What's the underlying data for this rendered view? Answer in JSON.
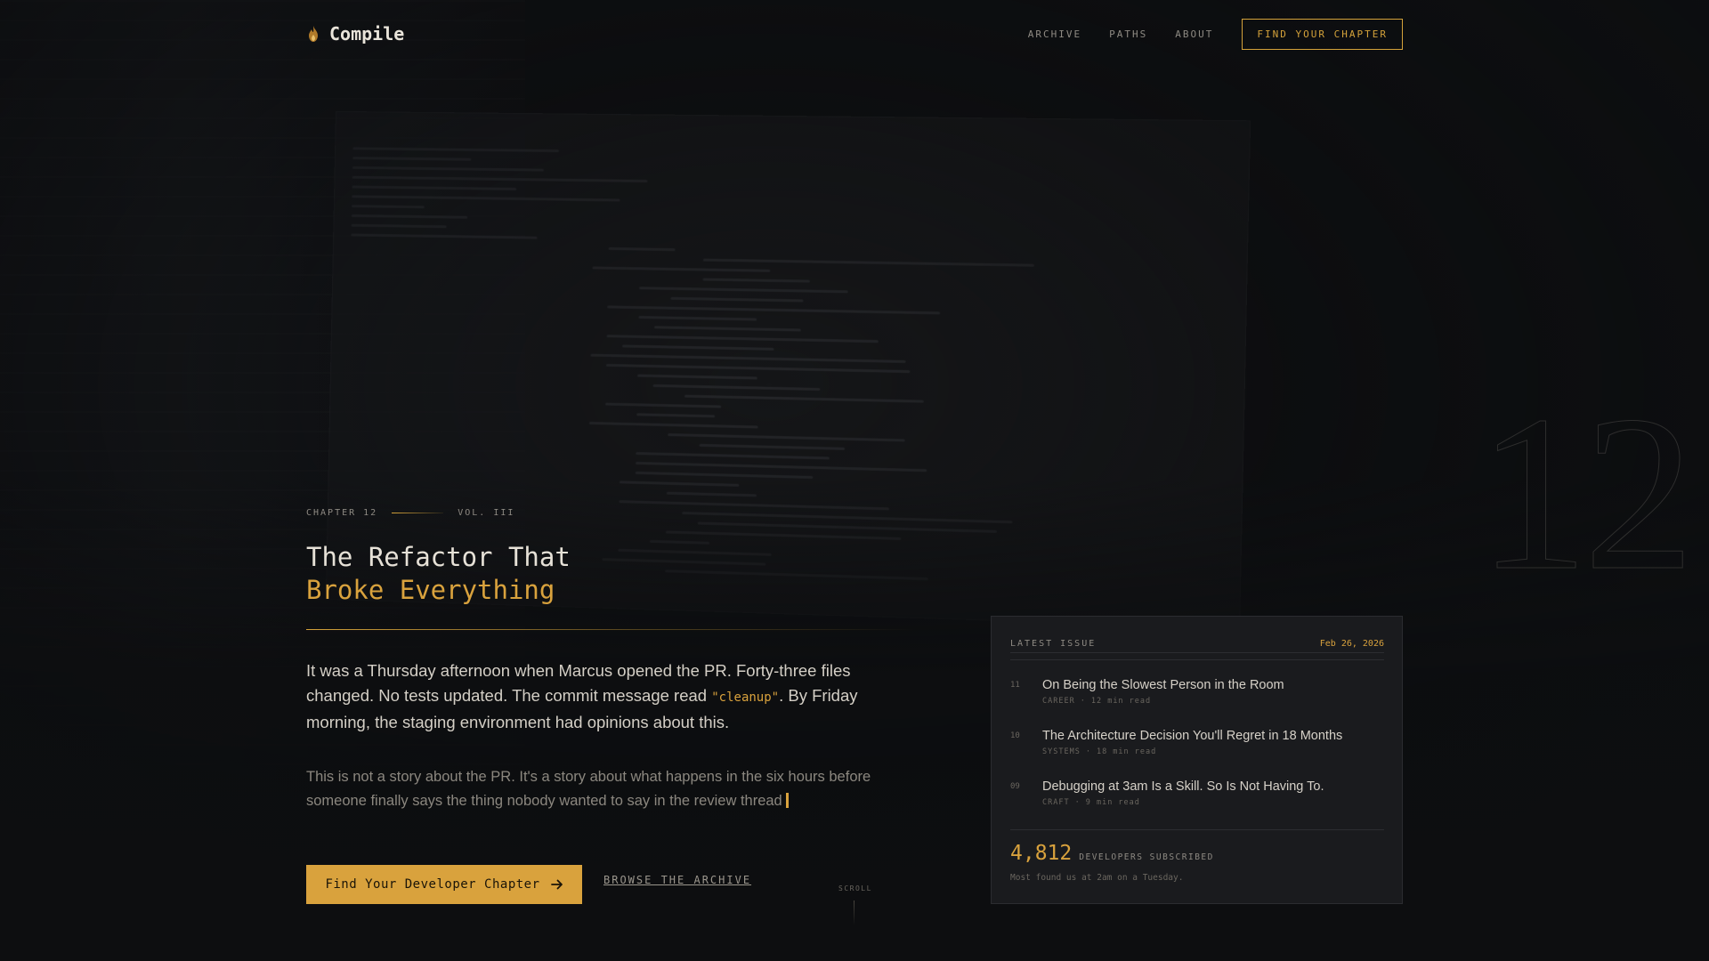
{
  "brand": {
    "name": "Compile",
    "icon": "flame-icon"
  },
  "nav": {
    "items": [
      "ARCHIVE",
      "PATHS",
      "ABOUT"
    ],
    "cta": "FIND YOUR CHAPTER"
  },
  "chapter": {
    "label": "CHAPTER 12",
    "volume": "VOL. III",
    "big_number": "12"
  },
  "headline": {
    "line1": "The Refactor That",
    "line2": "Broke Everything"
  },
  "lead": {
    "before": "It was a Thursday afternoon when Marcus opened the PR. Forty-three files changed. No tests updated. The commit message read ",
    "code": "\"cleanup\"",
    "after": ". By Friday morning, the staging environment had opinions about this."
  },
  "sub": "This is not a story about the PR. It's a story about what happens in the six hours before someone finally says the thing nobody wanted to say in the review thread",
  "actions": {
    "primary": "Find Your Developer Chapter",
    "primary_icon": "arrow-right-icon",
    "secondary": "BROWSE THE ARCHIVE",
    "scroll": "SCROLL"
  },
  "latest": {
    "label": "LATEST ISSUE",
    "date": "Feb 26, 2026",
    "issues": [
      {
        "num": "11",
        "title": "On Being the Slowest Person in the Room",
        "tag": "CAREER",
        "read": "12 min read"
      },
      {
        "num": "10",
        "title": "The Architecture Decision You'll Regret in 18 Months",
        "tag": "SYSTEMS",
        "read": "18 min read"
      },
      {
        "num": "09",
        "title": "Debugging at 3am Is a Skill. So Is Not Having To.",
        "tag": "CRAFT",
        "read": "9 min read"
      }
    ],
    "subscribers": "4,812",
    "subscribers_label": "DEVELOPERS SUBSCRIBED",
    "note": "Most found us at 2am on a Tuesday."
  },
  "colors": {
    "accent": "#d9a23d",
    "background": "#0d0e10",
    "card": "#1a1b1e"
  }
}
